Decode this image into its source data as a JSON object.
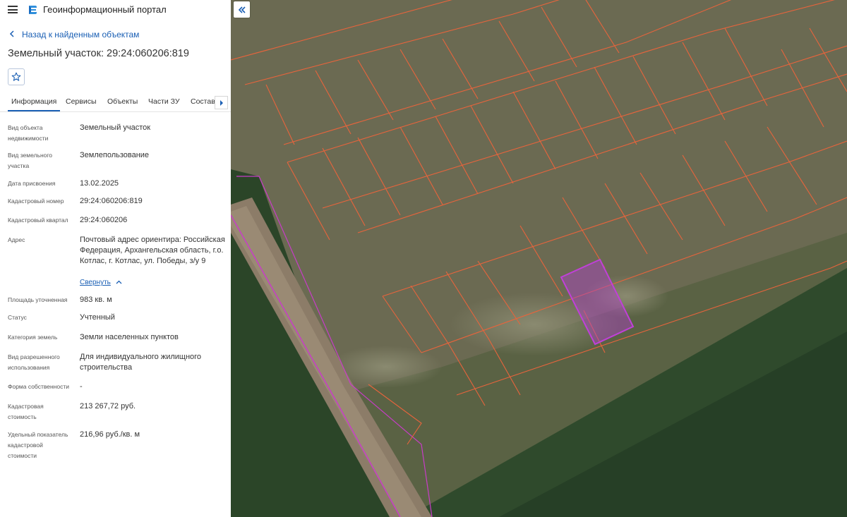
{
  "header": {
    "title": "Геоинформационный портал"
  },
  "nav": {
    "back_label": "Назад к найденным объектам"
  },
  "object": {
    "title": "Земельный участок: 29:24:060206:819"
  },
  "tabs": [
    {
      "label": "Информация"
    },
    {
      "label": "Сервисы"
    },
    {
      "label": "Объекты"
    },
    {
      "label": "Части ЗУ"
    },
    {
      "label": "Состав"
    }
  ],
  "info": {
    "fields": [
      {
        "label": "Вид объекта недвижимости",
        "value": "Земельный участок"
      },
      {
        "label": "Вид земельного участка",
        "value": "Землепользование"
      },
      {
        "label": "Дата присвоения",
        "value": "13.02.2025"
      },
      {
        "label": "Кадастровый номер",
        "value": "29:24:060206:819"
      },
      {
        "label": "Кадастровый квартал",
        "value": "29:24:060206"
      },
      {
        "label": "Адрес",
        "value": "Почтовый адрес ориентира: Российская Федерация, Архангельская область, г.о. Котлас, г. Котлас, ул. Победы, з/у 9"
      },
      {
        "label": "Площадь уточненная",
        "value": "983 кв. м"
      },
      {
        "label": "Статус",
        "value": "Учтенный"
      },
      {
        "label": "Категория земель",
        "value": "Земли населенных пунктов"
      },
      {
        "label": "Вид разрешенного использования",
        "value": "Для индивидуального жилищного строительства"
      },
      {
        "label": "Форма собственности",
        "value": "-"
      },
      {
        "label": "Кадастровая стоимость",
        "value": "213 267,72 руб."
      },
      {
        "label": "Удельный показатель кадастровой стоимости",
        "value": "216,96 руб./кв. м"
      }
    ],
    "collapse_label": "Свернуть"
  },
  "colors": {
    "accent": "#1a5fb4",
    "parcel_border": "#e8643c",
    "selected_parcel": "#b040c8",
    "road_border": "#c83cc8"
  }
}
